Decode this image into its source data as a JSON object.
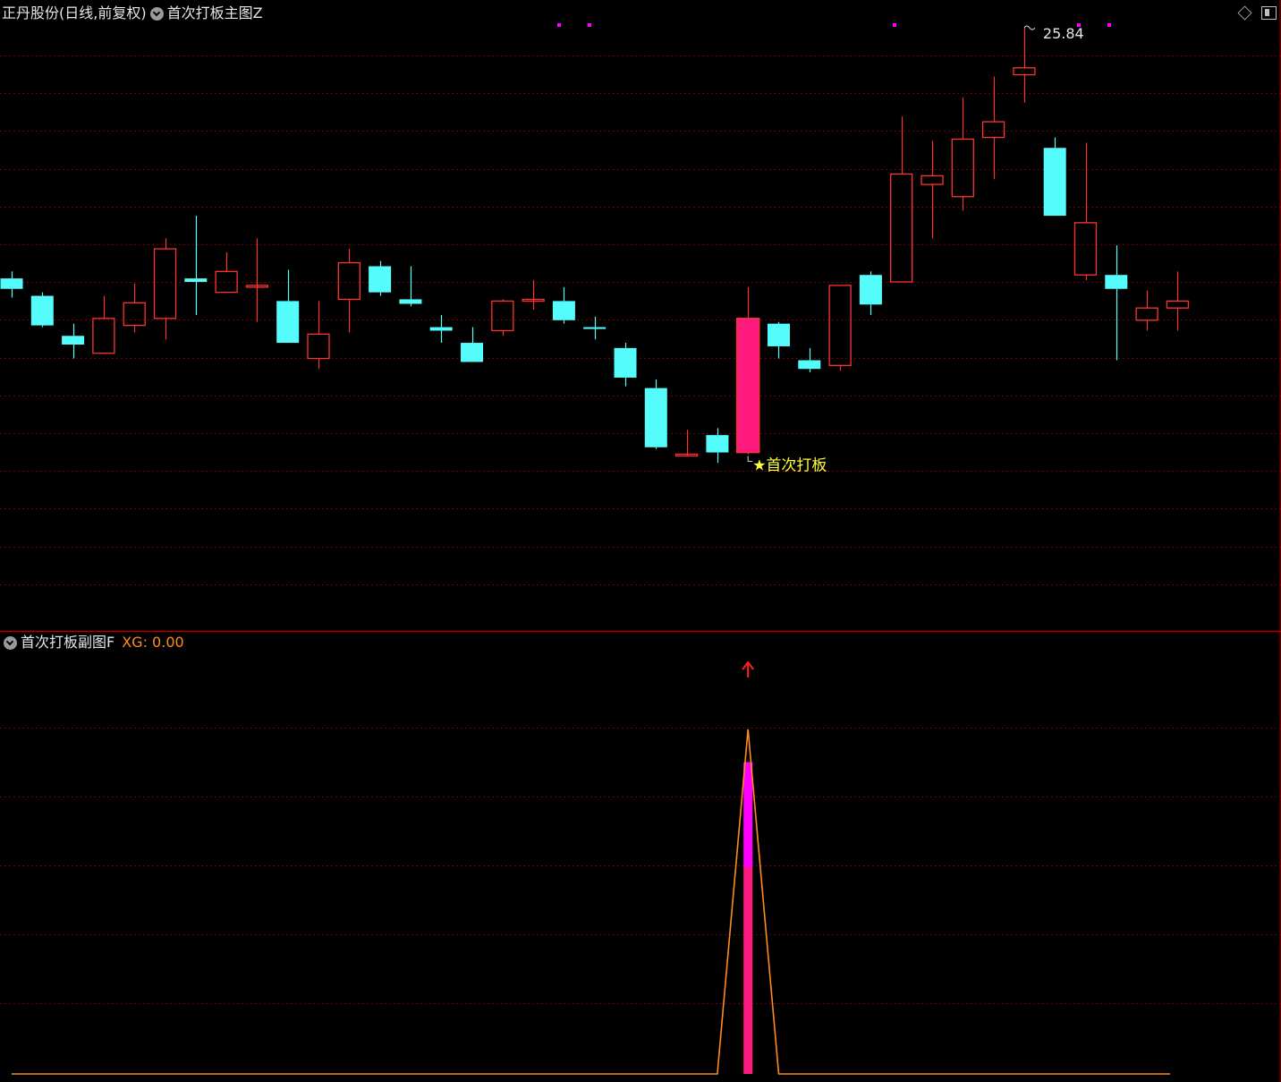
{
  "main_panel": {
    "stock_title": "正丹股份(日线,前复权)",
    "indicator_title": "首次打板主图Z",
    "peak_label": "25.84",
    "signal_label": "★首次打板"
  },
  "sub_panel": {
    "indicator_title": "首次打板副图F",
    "xg_label": "XG: 0.00"
  },
  "colors": {
    "up": "#ff3232",
    "down": "#54fcfc",
    "signal_bar": "#ff1a7f",
    "magenta": "#ff00ff",
    "orange_line": "#ff8c1a",
    "grid": "#7a0000",
    "separator": "#b00000",
    "label_yellow": "#ffff33"
  },
  "icons": [
    "chevron-down-icon",
    "diamond-icon",
    "window-icon",
    "up-arrow-icon"
  ],
  "chart_data": {
    "type": "candlestick",
    "price_scale": [
      11.2,
      27.5
    ],
    "candles": [
      {
        "o": 20.35,
        "c": 20.05,
        "h": 20.55,
        "l": 19.8
      },
      {
        "o": 19.85,
        "c": 19.0,
        "h": 19.95,
        "l": 18.95
      },
      {
        "o": 18.7,
        "c": 18.45,
        "h": 19.05,
        "l": 18.05
      },
      {
        "o": 18.2,
        "c": 19.2,
        "h": 19.85,
        "l": 18.2
      },
      {
        "o": 19.0,
        "c": 19.65,
        "h": 20.2,
        "l": 18.8
      },
      {
        "o": 19.2,
        "c": 21.2,
        "h": 21.5,
        "l": 18.6
      },
      {
        "o": 20.35,
        "c": 20.25,
        "h": 22.15,
        "l": 19.3
      },
      {
        "o": 19.95,
        "c": 20.55,
        "h": 21.1,
        "l": 19.95
      },
      {
        "o": 20.15,
        "c": 20.15,
        "h": 21.5,
        "l": 19.1
      },
      {
        "o": 19.7,
        "c": 18.5,
        "h": 20.6,
        "l": 18.5
      },
      {
        "o": 18.05,
        "c": 18.75,
        "h": 19.7,
        "l": 17.75
      },
      {
        "o": 19.75,
        "c": 20.8,
        "h": 21.2,
        "l": 18.8
      },
      {
        "o": 20.7,
        "c": 19.95,
        "h": 20.85,
        "l": 19.85
      },
      {
        "o": 19.75,
        "c": 19.62,
        "h": 20.7,
        "l": 19.55
      },
      {
        "o": 18.95,
        "c": 18.85,
        "h": 19.3,
        "l": 18.5
      },
      {
        "o": 18.5,
        "c": 17.95,
        "h": 18.95,
        "l": 17.95
      },
      {
        "o": 18.85,
        "c": 19.7,
        "h": 19.75,
        "l": 18.7
      },
      {
        "o": 19.75,
        "c": 19.75,
        "h": 20.3,
        "l": 19.45
      },
      {
        "o": 19.7,
        "c": 19.15,
        "h": 20.1,
        "l": 19.05
      },
      {
        "o": 18.95,
        "c": 18.9,
        "h": 19.25,
        "l": 18.6
      },
      {
        "o": 18.35,
        "c": 17.5,
        "h": 18.5,
        "l": 17.25
      },
      {
        "o": 17.2,
        "c": 15.5,
        "h": 17.45,
        "l": 15.45
      },
      {
        "o": 15.3,
        "c": 15.3,
        "h": 16.0,
        "l": 15.25
      },
      {
        "o": 15.85,
        "c": 15.35,
        "h": 16.05,
        "l": 15.05
      },
      {
        "o": 15.35,
        "c": 19.2,
        "h": 20.1,
        "l": 15.3
      },
      {
        "o": 19.05,
        "c": 18.4,
        "h": 19.1,
        "l": 18.05
      },
      {
        "o": 18.0,
        "c": 17.75,
        "h": 18.35,
        "l": 17.65
      },
      {
        "o": 17.85,
        "c": 20.15,
        "h": 20.15,
        "l": 17.7
      },
      {
        "o": 20.45,
        "c": 19.6,
        "h": 20.55,
        "l": 19.3
      },
      {
        "o": 20.25,
        "c": 23.35,
        "h": 25.0,
        "l": 20.25
      },
      {
        "o": 23.05,
        "c": 23.3,
        "h": 24.3,
        "l": 21.5
      },
      {
        "o": 22.7,
        "c": 24.35,
        "h": 25.55,
        "l": 22.3
      },
      {
        "o": 24.4,
        "c": 24.85,
        "h": 26.15,
        "l": 23.2
      },
      {
        "o": 26.2,
        "c": 26.4,
        "h": 27.55,
        "l": 25.4
      },
      {
        "o": 24.1,
        "c": 22.15,
        "h": 24.4,
        "l": 22.15
      },
      {
        "o": 20.45,
        "c": 21.95,
        "h": 24.25,
        "l": 20.3
      },
      {
        "o": 20.45,
        "c": 20.05,
        "h": 21.3,
        "l": 18.0
      },
      {
        "o": 19.15,
        "c": 19.5,
        "h": 20.0,
        "l": 18.85
      },
      {
        "o": 19.5,
        "c": 19.7,
        "h": 20.55,
        "l": 18.85
      }
    ],
    "signal_index": 24,
    "sub_series": {
      "name": "XG",
      "values": [
        0,
        0,
        0,
        0,
        0,
        0,
        0,
        0,
        0,
        0,
        0,
        0,
        0,
        0,
        0,
        0,
        0,
        0,
        0,
        0,
        0,
        0,
        0,
        0,
        1,
        0,
        0,
        0,
        0,
        0,
        0,
        0,
        0,
        0,
        0,
        0,
        0,
        0,
        0
      ],
      "ylim": [
        0,
        1
      ]
    }
  }
}
